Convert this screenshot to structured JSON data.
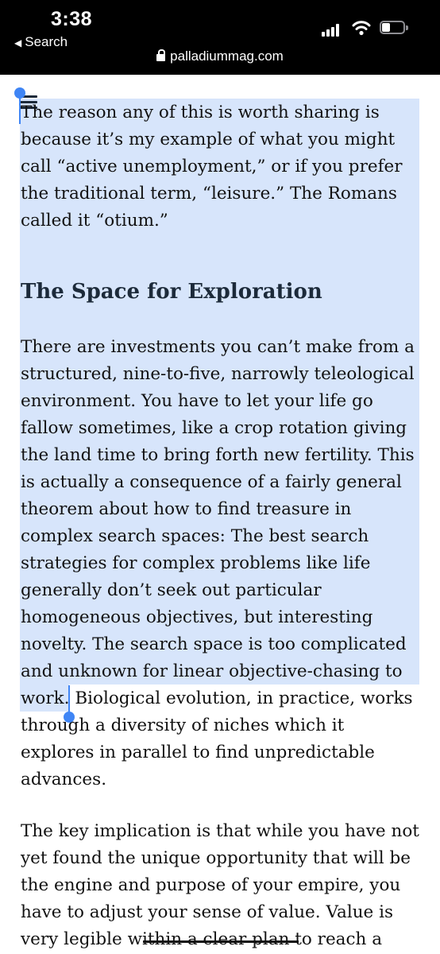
{
  "status_bar": {
    "time": "3:38",
    "back_label": "Search",
    "url": "palladiummag.com"
  },
  "article": {
    "para1": [
      "The reason any of this is worth sharing is",
      "because it’s my example of what you might",
      "call “active unemployment,” or if you prefer",
      "the traditional term, “leisure.” The Romans",
      "called it “otium.”"
    ],
    "heading": "The Space for Exploration",
    "para2": [
      "There are investments you can’t make from a",
      "structured, nine-to-five, narrowly teleological",
      "environment. You have to let your life go",
      "fallow sometimes, like a crop rotation giving",
      "the land time to bring forth new fertility. This",
      "is actually a consequence of a fairly general",
      "theorem about how to find treasure in",
      "complex search spaces: The best search",
      "strategies for complex problems like life",
      "generally don’t seek out particular",
      "homogeneous objectives, but interesting",
      "novelty. The search space is too complicated",
      "and unknown for linear objective-chasing to",
      "work. Biological evolution, in practice, works",
      "through a diversity of niches which it",
      "explores in parallel to find unpredictable",
      "advances."
    ],
    "para3": [
      "The key implication is that while you have not",
      "yet found the unique opportunity that will be",
      "the engine and purpose of your empire, you",
      "have to adjust your sense of value. Value is",
      "very legible within a clear plan to reach a"
    ]
  }
}
